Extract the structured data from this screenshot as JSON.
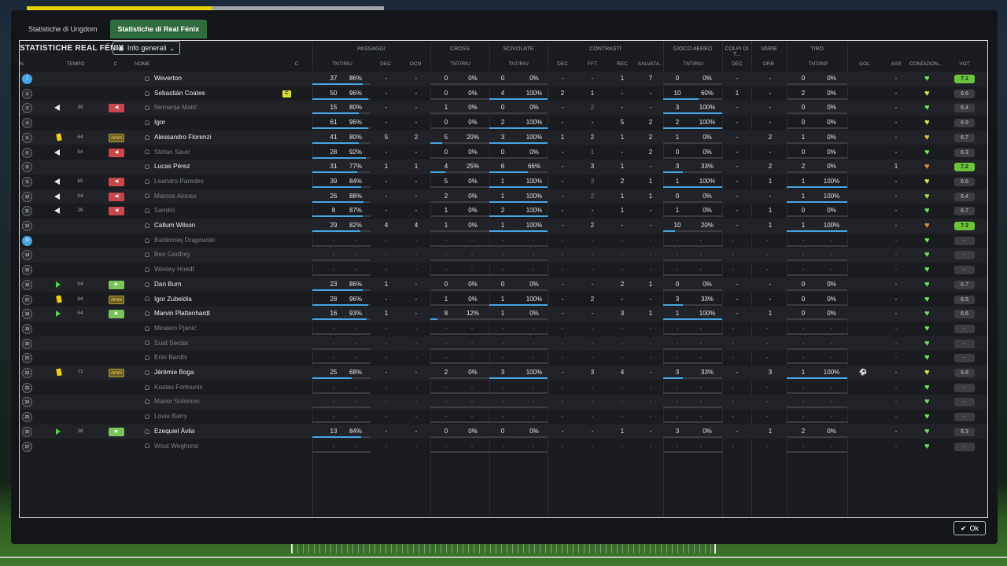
{
  "tabs": [
    "Statistiche di Ungdom",
    "Statistiche di Real Fénix"
  ],
  "panel_title": "STATISTICHE REAL FÉNIX",
  "view_dropdown": "Info generali",
  "ok_label": "Ok",
  "group_headers": [
    "PASSAGGI",
    "CROSS",
    "SCIVOLATE",
    "CONTRASTI",
    "GIOCO AEREO",
    "COLPI DI T...",
    "VARIE",
    "TIRO"
  ],
  "sub_headers": {
    "n": "N.",
    "tempo": "TEMPO",
    "c1": "C",
    "nome": "NOME",
    "c2": "C",
    "pass_tr": "TNT/RIU",
    "pass_dec": "DEC",
    "pass_ocn": "OCN",
    "cross_tr": "TNT/RIU",
    "sciv_tr": "TNT/RIU",
    "con_dec": "DEC",
    "con_fft": "FFT",
    "con_rec": "REC",
    "con_salv": "SALVATA...",
    "aer_tr": "TNT/RIU",
    "colpi_dec": "DEC",
    "varie_drb": "DRB",
    "tiro_tr": "TNT/INP",
    "gol": "GOL",
    "ass": "ASS",
    "cond": "CONDIZION...",
    "vot": "VOT"
  },
  "colors": {
    "accent_tab": "#2f6b3e",
    "bar": "#4aa3dc",
    "rating_good": "#6bc33a"
  },
  "players": [
    {
      "n": "1",
      "numblue": true,
      "event": "",
      "mins": "",
      "sub": "",
      "name": "Weverton",
      "captain": "",
      "dim": false,
      "pt": "37",
      "pp": "86%",
      "pf": 0.86,
      "pd": "-",
      "po": "-",
      "ct": "0",
      "cp": "0%",
      "cf": 0,
      "st": "0",
      "sp": "0%",
      "sf": 0,
      "cd": "-",
      "cff": "-",
      "cr": "1",
      "cs": "7",
      "at": "0",
      "ap": "0%",
      "af": 0,
      "hd": "-",
      "dr": "-",
      "tt": "0",
      "tp": "0%",
      "tf": 0,
      "gol": "",
      "ass": "-",
      "heart": "#6fe05a",
      "vot": "7.1",
      "good": true
    },
    {
      "n": "2",
      "event": "",
      "mins": "",
      "sub": "",
      "name": "Sebastián Coates",
      "captain": "C",
      "dim": false,
      "pt": "50",
      "pp": "96%",
      "pf": 0.96,
      "pd": "-",
      "po": "-",
      "ct": "0",
      "cp": "0%",
      "cf": 0,
      "st": "4",
      "sp": "100%",
      "sf": 1,
      "cd": "2",
      "cff": "1",
      "cr": "-",
      "cs": "-",
      "at": "10",
      "ap": "60%",
      "af": 0.6,
      "hd": "1",
      "dr": "-",
      "tt": "2",
      "tp": "0%",
      "tf": 0,
      "gol": "",
      "ass": "-",
      "heart": "#e0e04a",
      "vot": "6.6",
      "good": false
    },
    {
      "n": "3",
      "event": "out",
      "mins": "38",
      "sub": "out",
      "name": "Nemanja Matić",
      "captain": "",
      "dim": true,
      "pt": "15",
      "pp": "80%",
      "pf": 0.8,
      "pd": "-",
      "po": "-",
      "ct": "1",
      "cp": "0%",
      "cf": 0,
      "st": "0",
      "sp": "0%",
      "sf": 0,
      "cd": "-",
      "cff": "2",
      "cr": "-",
      "cs": "-",
      "at": "3",
      "ap": "100%",
      "af": 1,
      "hd": "-",
      "dr": "-",
      "tt": "0",
      "tp": "0%",
      "tf": 0,
      "gol": "",
      "ass": "-",
      "heart": "#6fe05a",
      "vot": "6.4",
      "good": false
    },
    {
      "n": "4",
      "event": "",
      "mins": "",
      "sub": "",
      "name": "Igor",
      "captain": "",
      "dim": false,
      "pt": "61",
      "pp": "96%",
      "pf": 0.96,
      "pd": "-",
      "po": "-",
      "ct": "0",
      "cp": "0%",
      "cf": 0,
      "st": "2",
      "sp": "100%",
      "sf": 1,
      "cd": "-",
      "cff": "-",
      "cr": "5",
      "cs": "2",
      "at": "2",
      "ap": "100%",
      "af": 1,
      "hd": "-",
      "dr": "-",
      "tt": "0",
      "tp": "0%",
      "tf": 0,
      "gol": "",
      "ass": "-",
      "heart": "#e0e04a",
      "vot": "6.9",
      "good": false
    },
    {
      "n": "5",
      "event": "yellow",
      "mins": "64",
      "sub": "amm",
      "name": "Alessandro Florenzi",
      "captain": "",
      "dim": false,
      "pt": "41",
      "pp": "80%",
      "pf": 0.8,
      "pd": "5",
      "po": "2",
      "ct": "5",
      "cp": "20%",
      "cf": 0.2,
      "st": "3",
      "sp": "100%",
      "sf": 1,
      "cd": "1",
      "cff": "2",
      "cr": "1",
      "cs": "2",
      "at": "1",
      "ap": "0%",
      "af": 0,
      "hd": "-",
      "dr": "2",
      "tt": "1",
      "tp": "0%",
      "tf": 0,
      "gol": "",
      "ass": "-",
      "heart": "#e0c040",
      "vot": "6.7",
      "good": false
    },
    {
      "n": "6",
      "event": "out",
      "mins": "54",
      "sub": "out",
      "name": "Stefan Savić",
      "captain": "",
      "dim": true,
      "pt": "28",
      "pp": "92%",
      "pf": 0.92,
      "pd": "-",
      "po": "-",
      "ct": "0",
      "cp": "0%",
      "cf": 0,
      "st": "0",
      "sp": "0%",
      "sf": 0,
      "cd": "-",
      "cff": "1",
      "cr": "-",
      "cs": "2",
      "at": "0",
      "ap": "0%",
      "af": 0,
      "hd": "-",
      "dr": "-",
      "tt": "0",
      "tp": "0%",
      "tf": 0,
      "gol": "",
      "ass": "-",
      "heart": "#6fe05a",
      "vot": "6.3",
      "good": false
    },
    {
      "n": "8",
      "event": "",
      "mins": "",
      "sub": "",
      "name": "Lucas Pérez",
      "captain": "",
      "dim": false,
      "pt": "31",
      "pp": "77%",
      "pf": 0.77,
      "pd": "1",
      "po": "1",
      "ct": "4",
      "cp": "25%",
      "cf": 0.25,
      "st": "6",
      "sp": "66%",
      "sf": 0.66,
      "cd": "-",
      "cff": "3",
      "cr": "1",
      "cs": "-",
      "at": "3",
      "ap": "33%",
      "af": 0.33,
      "hd": "-",
      "dr": "2",
      "tt": "2",
      "tp": "0%",
      "tf": 0,
      "gol": "",
      "ass": "1",
      "heart": "#e08a3a",
      "vot": "7.2",
      "good": true
    },
    {
      "n": "9",
      "event": "out",
      "mins": "65",
      "sub": "out",
      "name": "Leandro Paredes",
      "captain": "",
      "dim": true,
      "pt": "39",
      "pp": "84%",
      "pf": 0.84,
      "pd": "-",
      "po": "-",
      "ct": "5",
      "cp": "0%",
      "cf": 0,
      "st": "1",
      "sp": "100%",
      "sf": 1,
      "cd": "-",
      "cff": "3",
      "cr": "2",
      "cs": "1",
      "at": "1",
      "ap": "100%",
      "af": 1,
      "hd": "-",
      "dr": "1",
      "tt": "1",
      "tp": "100%",
      "tf": 1,
      "gol": "",
      "ass": "-",
      "heart": "#e0e04a",
      "vot": "6.6",
      "good": false
    },
    {
      "n": "10",
      "event": "out",
      "mins": "54",
      "sub": "out",
      "name": "Marcos Alonso",
      "captain": "",
      "dim": true,
      "pt": "26",
      "pp": "88%",
      "pf": 0.88,
      "pd": "-",
      "po": "-",
      "ct": "2",
      "cp": "0%",
      "cf": 0,
      "st": "1",
      "sp": "100%",
      "sf": 1,
      "cd": "-",
      "cff": "2",
      "cr": "1",
      "cs": "1",
      "at": "0",
      "ap": "0%",
      "af": 0,
      "hd": "-",
      "dr": "-",
      "tt": "1",
      "tp": "100%",
      "tf": 1,
      "gol": "",
      "ass": "-",
      "heart": "#a8e04a",
      "vot": "6.4",
      "good": false
    },
    {
      "n": "11",
      "event": "out",
      "mins": "26",
      "sub": "out",
      "name": "Sandro",
      "captain": "",
      "dim": true,
      "pt": "8",
      "pp": "87%",
      "pf": 0.87,
      "pd": "-",
      "po": "-",
      "ct": "1",
      "cp": "0%",
      "cf": 0,
      "st": "2",
      "sp": "100%",
      "sf": 1,
      "cd": "-",
      "cff": "-",
      "cr": "1",
      "cs": "-",
      "at": "1",
      "ap": "0%",
      "af": 0,
      "hd": "-",
      "dr": "1",
      "tt": "0",
      "tp": "0%",
      "tf": 0,
      "gol": "",
      "ass": "-",
      "heart": "#6fe05a",
      "vot": "6.7",
      "good": false
    },
    {
      "n": "12",
      "event": "",
      "mins": "",
      "sub": "",
      "name": "Callum Wilson",
      "captain": "",
      "dim": false,
      "pt": "29",
      "pp": "82%",
      "pf": 0.82,
      "pd": "4",
      "po": "4",
      "ct": "1",
      "cp": "0%",
      "cf": 0,
      "st": "1",
      "sp": "100%",
      "sf": 1,
      "cd": "-",
      "cff": "2",
      "cr": "-",
      "cs": "-",
      "at": "10",
      "ap": "20%",
      "af": 0.2,
      "hd": "-",
      "dr": "1",
      "tt": "1",
      "tp": "100%",
      "tf": 1,
      "gol": "",
      "ass": "-",
      "heart": "#e08a3a",
      "vot": "7.3",
      "good": true
    },
    {
      "n": "13",
      "numblue": true,
      "event": "",
      "mins": "",
      "sub": "",
      "name": "Bartłomiej Drągowski",
      "captain": "",
      "dim": true,
      "empty": true,
      "heart": "#6fe05a",
      "vot": "-",
      "good": false
    },
    {
      "n": "14",
      "event": "",
      "mins": "",
      "sub": "",
      "name": "Ben Godfrey",
      "captain": "",
      "dim": true,
      "empty": true,
      "heart": "#6fe05a",
      "vot": "-",
      "good": false
    },
    {
      "n": "15",
      "event": "",
      "mins": "",
      "sub": "",
      "name": "Wesley Hoedt",
      "captain": "",
      "dim": true,
      "empty": true,
      "heart": "#6fe05a",
      "vot": "-",
      "good": false
    },
    {
      "n": "16",
      "event": "in",
      "mins": "54",
      "sub": "in",
      "name": "Dan Burn",
      "captain": "",
      "dim": false,
      "pt": "23",
      "pp": "86%",
      "pf": 0.86,
      "pd": "1",
      "po": "-",
      "ct": "0",
      "cp": "0%",
      "cf": 0,
      "st": "0",
      "sp": "0%",
      "sf": 0,
      "cd": "-",
      "cff": "-",
      "cr": "2",
      "cs": "1",
      "at": "0",
      "ap": "0%",
      "af": 0,
      "hd": "-",
      "dr": "-",
      "tt": "0",
      "tp": "0%",
      "tf": 0,
      "gol": "",
      "ass": "-",
      "heart": "#6fe05a",
      "vot": "6.7",
      "good": false
    },
    {
      "n": "17",
      "event": "yellow",
      "mins": "84",
      "sub": "amm",
      "name": "Igor Zubeldia",
      "captain": "",
      "dim": false,
      "pt": "28",
      "pp": "96%",
      "pf": 0.96,
      "pd": "-",
      "po": "-",
      "ct": "1",
      "cp": "0%",
      "cf": 0,
      "st": "1",
      "sp": "100%",
      "sf": 1,
      "cd": "-",
      "cff": "2",
      "cr": "-",
      "cs": "-",
      "at": "3",
      "ap": "33%",
      "af": 0.33,
      "hd": "-",
      "dr": "-",
      "tt": "0",
      "tp": "0%",
      "tf": 0,
      "gol": "",
      "ass": "-",
      "heart": "#6fe05a",
      "vot": "6.5",
      "good": false
    },
    {
      "n": "18",
      "event": "in",
      "mins": "54",
      "sub": "in",
      "name": "Marvin Plattenhardt",
      "captain": "",
      "dim": false,
      "pt": "16",
      "pp": "93%",
      "pf": 0.93,
      "pd": "1",
      "po": "-",
      "ct": "8",
      "cp": "12%",
      "cf": 0.12,
      "st": "1",
      "sp": "0%",
      "sf": 0,
      "cd": "-",
      "cff": "-",
      "cr": "3",
      "cs": "1",
      "at": "1",
      "ap": "100%",
      "af": 1,
      "hd": "-",
      "dr": "1",
      "tt": "0",
      "tp": "0%",
      "tf": 0,
      "gol": "",
      "ass": "-",
      "heart": "#6fe05a",
      "vot": "6.6",
      "good": false
    },
    {
      "n": "19",
      "event": "",
      "mins": "",
      "sub": "",
      "name": "Miralem Pjanić",
      "captain": "",
      "dim": true,
      "empty": true,
      "heart": "#6fe05a",
      "vot": "-",
      "good": false
    },
    {
      "n": "20",
      "event": "",
      "mins": "",
      "sub": "",
      "name": "Suat Serdar",
      "captain": "",
      "dim": true,
      "empty": true,
      "heart": "#6fe05a",
      "vot": "-",
      "good": false
    },
    {
      "n": "21",
      "event": "",
      "mins": "",
      "sub": "",
      "name": "Enis Bardhi",
      "captain": "",
      "dim": true,
      "empty": true,
      "heart": "#6fe05a",
      "vot": "-",
      "good": false
    },
    {
      "n": "22",
      "event": "yellow",
      "mins": "77",
      "sub": "amm",
      "name": "Jérémie Boga",
      "captain": "",
      "dim": false,
      "pt": "25",
      "pp": "68%",
      "pf": 0.68,
      "pd": "-",
      "po": "-",
      "ct": "2",
      "cp": "0%",
      "cf": 0,
      "st": "3",
      "sp": "100%",
      "sf": 1,
      "cd": "-",
      "cff": "3",
      "cr": "4",
      "cs": "-",
      "at": "3",
      "ap": "33%",
      "af": 0.33,
      "hd": "-",
      "dr": "3",
      "tt": "1",
      "tp": "100%",
      "tf": 1,
      "gol": "ball",
      "ass": "-",
      "heart": "#e0e04a",
      "vot": "6.8",
      "good": false
    },
    {
      "n": "23",
      "event": "",
      "mins": "",
      "sub": "",
      "name": "Kostas Fortounis",
      "captain": "",
      "dim": true,
      "empty": true,
      "heart": "#6fe05a",
      "vot": "-",
      "good": false
    },
    {
      "n": "24",
      "event": "",
      "mins": "",
      "sub": "",
      "name": "Manor Solomon",
      "captain": "",
      "dim": true,
      "empty": true,
      "heart": "#6fe05a",
      "vot": "-",
      "good": false
    },
    {
      "n": "25",
      "event": "",
      "mins": "",
      "sub": "",
      "name": "Louie Barry",
      "captain": "",
      "dim": true,
      "empty": true,
      "heart": "#6fe05a",
      "vot": "-",
      "good": false
    },
    {
      "n": "26",
      "event": "in",
      "mins": "38",
      "sub": "in",
      "name": "Ezequiel Ávila",
      "captain": "",
      "dim": false,
      "pt": "13",
      "pp": "84%",
      "pf": 0.84,
      "pd": "-",
      "po": "-",
      "ct": "0",
      "cp": "0%",
      "cf": 0,
      "st": "0",
      "sp": "0%",
      "sf": 0,
      "cd": "-",
      "cff": "-",
      "cr": "1",
      "cs": "-",
      "at": "3",
      "ap": "0%",
      "af": 0,
      "hd": "-",
      "dr": "1",
      "tt": "2",
      "tp": "0%",
      "tf": 0,
      "gol": "",
      "ass": "-",
      "heart": "#6fe05a",
      "vot": "6.3",
      "good": false
    },
    {
      "n": "27",
      "event": "",
      "mins": "",
      "sub": "",
      "name": "Wout Weghorst",
      "captain": "",
      "dim": true,
      "empty": true,
      "heart": "#6fe05a",
      "vot": "-",
      "good": false
    }
  ],
  "sub_labels": {
    "out": "◀",
    "in": "▶",
    "amm": "Amm"
  }
}
